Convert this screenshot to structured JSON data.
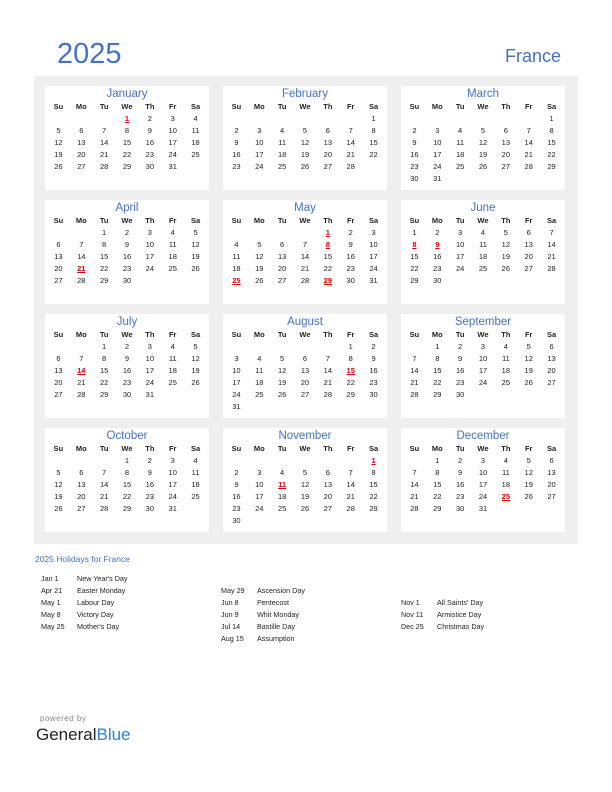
{
  "header": {
    "year": "2025",
    "country": "France"
  },
  "weekdays": [
    "Su",
    "Mo",
    "Tu",
    "We",
    "Th",
    "Fr",
    "Sa"
  ],
  "months": [
    {
      "name": "January",
      "offset": 3,
      "days": 31,
      "holidays": [
        1
      ]
    },
    {
      "name": "February",
      "offset": 6,
      "days": 28,
      "holidays": []
    },
    {
      "name": "March",
      "offset": 6,
      "days": 31,
      "holidays": []
    },
    {
      "name": "April",
      "offset": 2,
      "days": 30,
      "holidays": [
        21
      ]
    },
    {
      "name": "May",
      "offset": 4,
      "days": 31,
      "holidays": [
        1,
        8,
        25,
        29
      ]
    },
    {
      "name": "June",
      "offset": 0,
      "days": 30,
      "holidays": [
        8,
        9
      ]
    },
    {
      "name": "July",
      "offset": 2,
      "days": 31,
      "holidays": [
        14
      ]
    },
    {
      "name": "August",
      "offset": 5,
      "days": 31,
      "holidays": [
        15
      ]
    },
    {
      "name": "September",
      "offset": 1,
      "days": 30,
      "holidays": []
    },
    {
      "name": "October",
      "offset": 3,
      "days": 31,
      "holidays": []
    },
    {
      "name": "November",
      "offset": 6,
      "days": 30,
      "holidays": [
        1,
        11
      ]
    },
    {
      "name": "December",
      "offset": 1,
      "days": 31,
      "holidays": [
        25
      ]
    }
  ],
  "holidays_title": "2025 Holidays for France",
  "holiday_columns": [
    [
      {
        "date": "Jan 1",
        "name": "New Year's Day"
      },
      {
        "date": "Apr 21",
        "name": "Easter Monday"
      },
      {
        "date": "May 1",
        "name": "Labour Day"
      },
      {
        "date": "May 8",
        "name": "Victory Day"
      },
      {
        "date": "May 25",
        "name": "Mother's Day"
      }
    ],
    [
      {
        "date": "May 29",
        "name": "Ascension Day"
      },
      {
        "date": "Jun 8",
        "name": "Pentecost"
      },
      {
        "date": "Jun 9",
        "name": "Whit Monday"
      },
      {
        "date": "Jul 14",
        "name": "Bastille Day"
      },
      {
        "date": "Aug 15",
        "name": "Assumption"
      }
    ],
    [
      {
        "date": "Nov 1",
        "name": "All Saints' Day"
      },
      {
        "date": "Nov 11",
        "name": "Armistice Day"
      },
      {
        "date": "Dec 25",
        "name": "Christmas Day"
      }
    ]
  ],
  "footer": {
    "powered_by": "powered by",
    "brand_general": "General",
    "brand_blue": "Blue"
  }
}
